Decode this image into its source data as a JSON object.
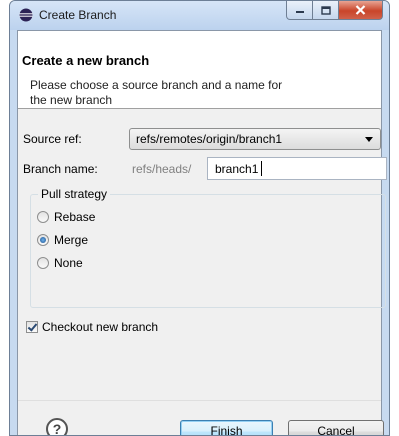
{
  "window": {
    "title": "Create Branch"
  },
  "banner": {
    "title": "Create a new branch",
    "message": "Please choose a source branch and a name for the new branch"
  },
  "form": {
    "source_ref_label": "Source ref:",
    "source_ref_value": "refs/remotes/origin/branch1",
    "branch_name_label": "Branch name:",
    "branch_name_prefix": "refs/heads/",
    "branch_name_value": "branch1"
  },
  "pull_strategy": {
    "title": "Pull strategy",
    "options": [
      {
        "label": "Rebase",
        "selected": false
      },
      {
        "label": "Merge",
        "selected": true
      },
      {
        "label": "None",
        "selected": false
      }
    ]
  },
  "checkout": {
    "label": "Checkout new branch",
    "checked": true
  },
  "footer": {
    "help_glyph": "?",
    "finish_label": "Finish",
    "cancel_label": "Cancel"
  }
}
